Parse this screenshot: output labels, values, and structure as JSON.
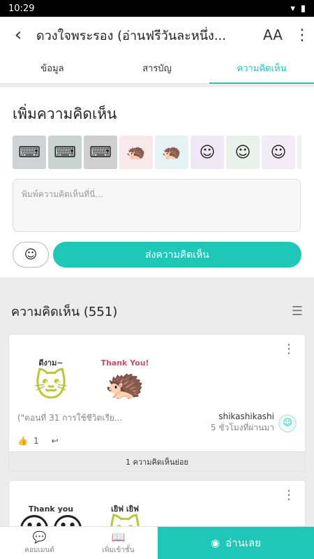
{
  "status": {
    "time": "10:29"
  },
  "appbar": {
    "title": "ดวงใจพระรอง (อ่านฟรีวันละหนึ่ง...",
    "font_button": "AA"
  },
  "tabs": [
    {
      "label": "ข้อมูล"
    },
    {
      "label": "สารบัญ"
    },
    {
      "label": "ความคิดเห็น"
    }
  ],
  "add_comment": {
    "heading": "เพิ่มความคิดเห็น",
    "placeholder": "พิมพ์ความคิดเห็นที่นี่...",
    "send_label": "ส่งความคิดเห็น"
  },
  "comments_section": {
    "heading": "ความคิดเห็น (551)"
  },
  "comments": [
    {
      "sticker_captions": [
        "ดีงาม~",
        "Thank You!"
      ],
      "excerpt": "(\"ตอนที่ 31 การใช้ชีวิตเรีย...",
      "author": "shikashikashi",
      "time": "5 ชั่วโมงที่ผ่านมา",
      "likes": "1",
      "replies_label": "1 ความคิดเห็นย่อย"
    },
    {
      "sticker_captions": [
        "Thank you",
        "เยิฟ เยิฟ"
      ]
    }
  ],
  "bottom_nav": {
    "comment_label": "คอมเมนต์",
    "shelf_label": "เพิ่มเข้าชั้น",
    "read_label": "อ่านเลย"
  },
  "colors": {
    "accent": "#1fc7b8"
  }
}
